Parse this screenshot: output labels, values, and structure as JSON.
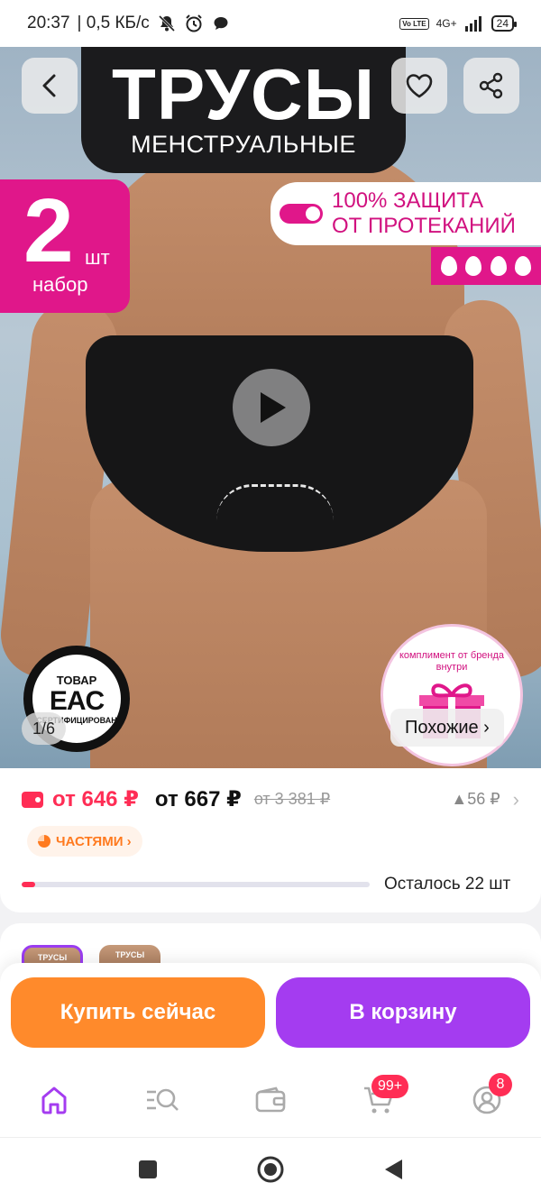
{
  "status_bar": {
    "time": "20:37",
    "speed": "| 0,5 КБ/с",
    "volte": "Vo LTE",
    "network": "4G+",
    "battery": "24"
  },
  "hero": {
    "title": "ТРУСЫ",
    "subtitle": "МЕНСТРУАЛЬНЫЕ",
    "pack_count": "2",
    "pack_unit": "шт",
    "pack_label": "набор",
    "protection_line1": "100% ЗАЩИТА",
    "protection_line2": "ОТ ПРОТЕКАНИЙ",
    "cert_top": "ТОВАР",
    "cert_mark": "EAC",
    "cert_bottom": "СЕРТИФИЦИРОВАН",
    "gift_text": "комплимент от бренда внутри",
    "page_indicator": "1/6",
    "similar_label": "Похожие ›"
  },
  "price": {
    "wallet_price": "от 646 ₽",
    "main_price": "от 667 ₽",
    "old_price": "от 3 381 ₽",
    "price_change": "▲56 ₽",
    "installments_label": "ЧАСТЯМИ ›",
    "stock_text": "Осталось 22 шт",
    "stock_fraction": 0.04
  },
  "variants": {
    "thumb_label": "ТРУСЫ"
  },
  "actions": {
    "buy_now": "Купить сейчас",
    "add_to_cart": "В корзину"
  },
  "nav": {
    "cart_badge": "99+",
    "profile_badge": "8"
  },
  "colors": {
    "accent_pink": "#e0178a",
    "price_red": "#ff2d55",
    "buy_orange": "#ff8a2b",
    "cart_purple": "#a43cf0"
  }
}
